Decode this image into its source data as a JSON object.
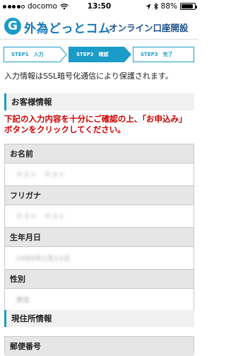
{
  "status_bar": {
    "carrier": "docomo",
    "time": "13:50",
    "battery": "88%",
    "battery_level": 0.88
  },
  "header": {
    "logo_mark": "G",
    "logo_text": "外為どっとコム",
    "subtitle": "オンライン口座開設"
  },
  "steps": [
    {
      "label": "STEP1　入力",
      "active": false
    },
    {
      "label": "STEP2　確認",
      "active": true
    },
    {
      "label": "STEP3　完了",
      "active": false
    }
  ],
  "notice": "入力情報はSSL暗号化通信により保護されます。",
  "customer_section": {
    "title": "お客様情報"
  },
  "warning": "下記の入力内容を十分にご確認の上、「お申込み」ボタンをクリックしてください。",
  "fields": [
    {
      "label": "お名前",
      "value": "テスト　テスト"
    },
    {
      "label": "フリガナ",
      "value": "テスト　テスト"
    },
    {
      "label": "生年月日",
      "value": "1988年1月12日"
    },
    {
      "label": "性別",
      "value": "男性"
    }
  ],
  "address_section": {
    "title": "現住所情報"
  },
  "address_fields": [
    {
      "label": "郵便番号"
    }
  ],
  "colors": {
    "accent": "#1a9bc8",
    "warning": "#cc0000",
    "logo_blue": "#1478b8"
  }
}
